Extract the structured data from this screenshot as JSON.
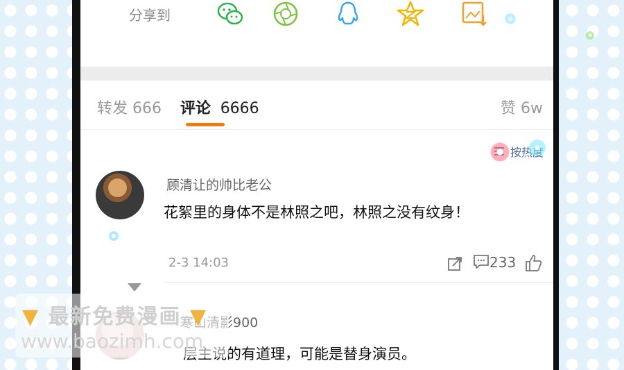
{
  "share": {
    "label": "分享到",
    "icons": [
      "wechat-icon",
      "moments-icon",
      "qq-icon",
      "qzone-icon",
      "save-image-icon"
    ]
  },
  "tabs": {
    "repost_label": "转发",
    "repost_count": "666",
    "comment_label": "评论",
    "comment_count": "6666",
    "like_label": "赞",
    "like_count": "6w"
  },
  "sort": {
    "label": "按热度",
    "icon": "sort-icon"
  },
  "comments": [
    {
      "username": "顾清让的帅比老公",
      "text": "花絮里的身体不是林照之吧，林照之没有纹身！",
      "time": "2-3 14:03",
      "reply_count": "233"
    },
    {
      "username": "寒山清影900",
      "text": "层主说的有道理，可能是替身演员。"
    }
  ],
  "watermark": {
    "line1": "最新免费漫画",
    "line2": "www.baozimh.com"
  },
  "colors": {
    "accent": "#ef7a16",
    "share_green": "#2bb24c",
    "share_lime": "#7cc242",
    "share_blue": "#38a6e8",
    "share_gold": "#f4b400",
    "share_orange": "#f0a030"
  }
}
